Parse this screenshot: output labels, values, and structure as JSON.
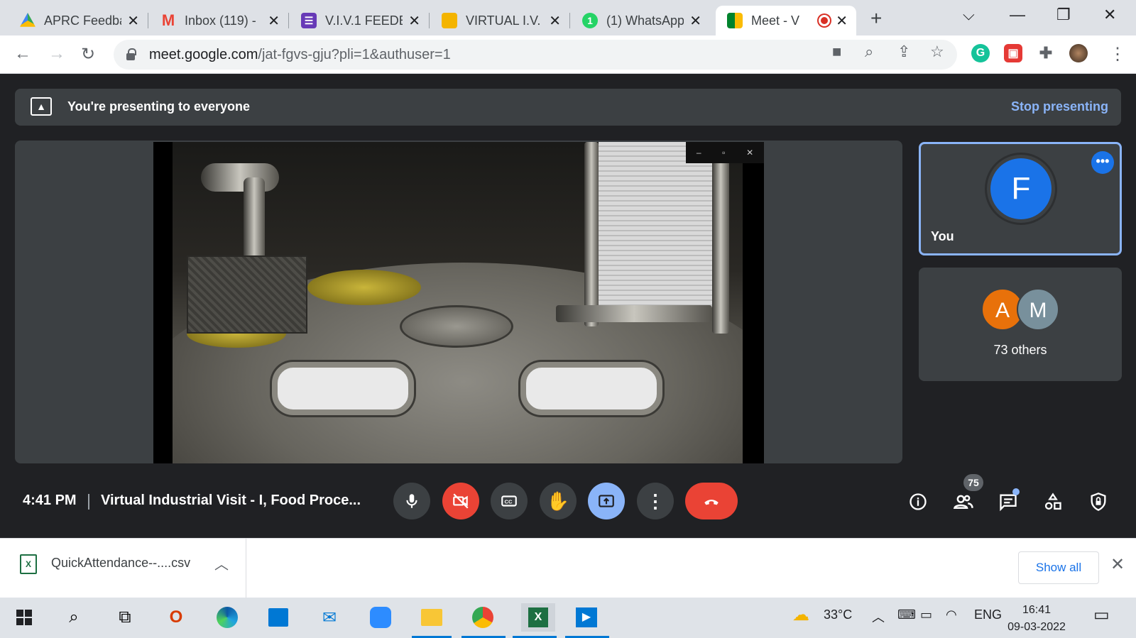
{
  "browser": {
    "tabs": [
      {
        "title": "APRC Feedba",
        "icon": "google-drive-icon",
        "color": "#34a853"
      },
      {
        "title": "Inbox (119) -",
        "icon": "gmail-icon",
        "color": "#ea4335"
      },
      {
        "title": "V.I.V.1 FEEDB/",
        "icon": "google-forms-icon",
        "color": "#673ab7"
      },
      {
        "title": "VIRTUAL I.V. -",
        "icon": "google-slides-icon",
        "color": "#f4b400"
      },
      {
        "title": "(1) WhatsApp",
        "icon": "whatsapp-icon",
        "color": "#25d366"
      },
      {
        "title": "Meet - V",
        "icon": "google-meet-icon",
        "color": "#00832d"
      }
    ],
    "url_domain": "meet.google.com",
    "url_path": "/jat-fgvs-gju?pli=1&authuser=1"
  },
  "banner": {
    "text": "You're presenting to everyone",
    "stop": "Stop presenting"
  },
  "participants": {
    "you_initial": "F",
    "you_label": "You",
    "others": [
      {
        "initial": "A",
        "color": "#e8710a"
      },
      {
        "initial": "M",
        "color": "#78909c"
      }
    ],
    "others_label": "73 others",
    "count": "75"
  },
  "meeting": {
    "time": "4:41 PM",
    "title": "Virtual Industrial Visit - I, Food Proce..."
  },
  "download": {
    "file": "QuickAttendance--....csv",
    "show_all": "Show all"
  },
  "taskbar": {
    "weather": "33°C",
    "lang": "ENG",
    "time": "16:41",
    "date": "09-03-2022"
  }
}
